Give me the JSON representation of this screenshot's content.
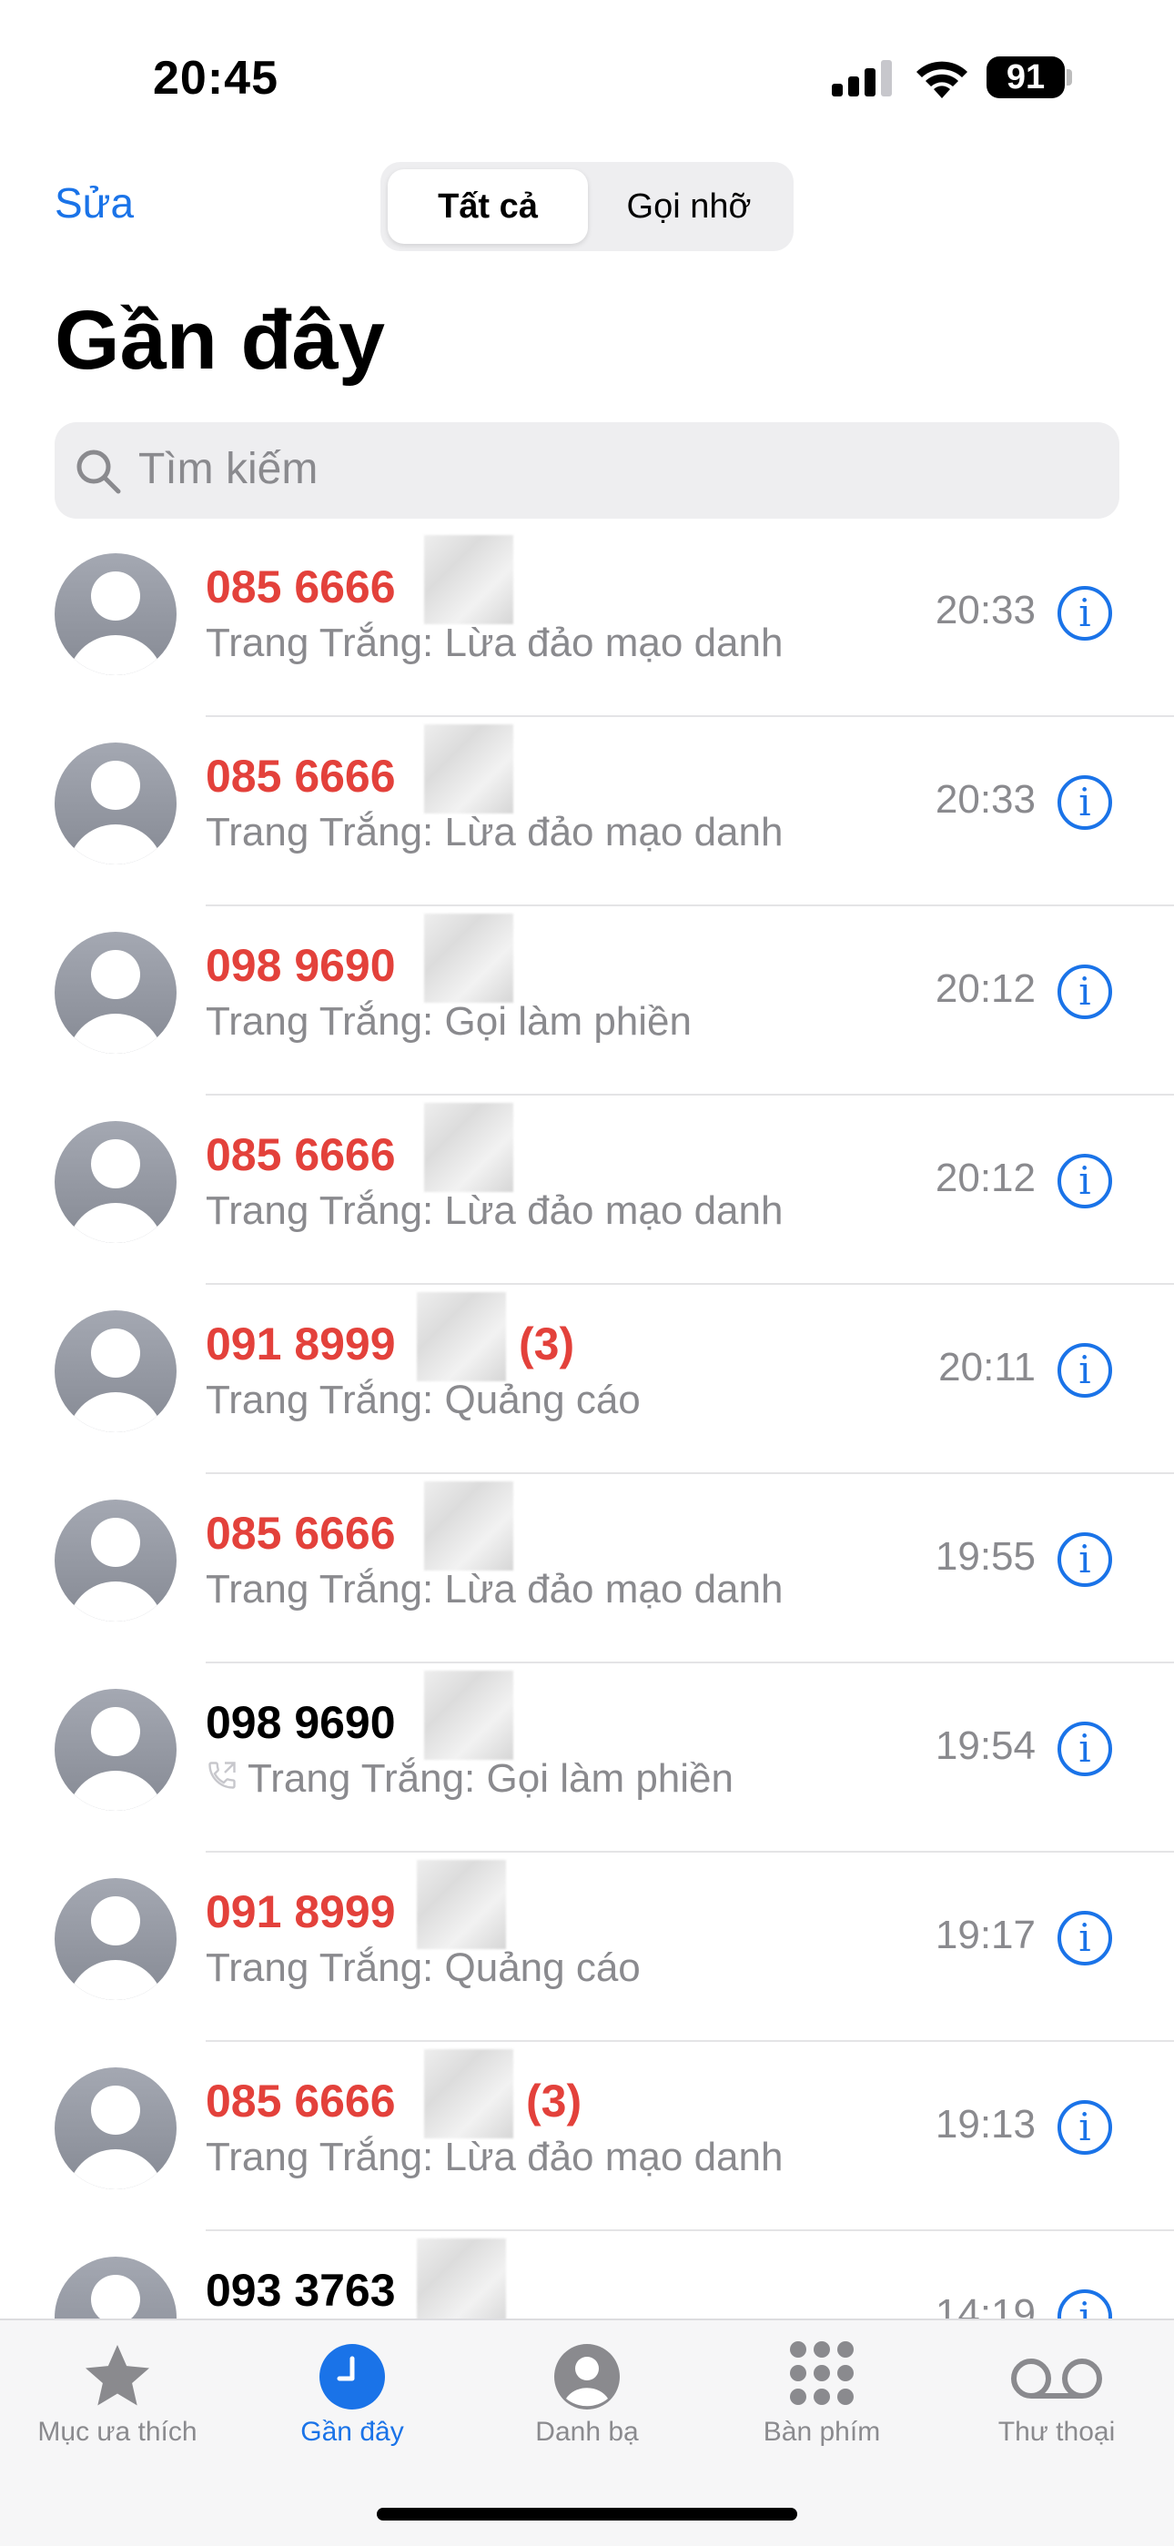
{
  "status": {
    "time": "20:45",
    "battery": "91"
  },
  "nav": {
    "edit": "Sửa",
    "seg_all": "Tất cả",
    "seg_missed": "Gọi nhỡ",
    "title": "Gần đây"
  },
  "search": {
    "placeholder": "Tìm kiếm"
  },
  "calls": [
    {
      "number": "085 6666",
      "count": "",
      "label": "Trang Trắng: Lừa đảo mạo danh",
      "time": "20:33",
      "missed": true,
      "outgoing": false
    },
    {
      "number": "085 6666",
      "count": "",
      "label": "Trang Trắng: Lừa đảo mạo danh",
      "time": "20:33",
      "missed": true,
      "outgoing": false
    },
    {
      "number": "098 9690",
      "count": "",
      "label": "Trang Trắng: Gọi làm phiền",
      "time": "20:12",
      "missed": true,
      "outgoing": false
    },
    {
      "number": "085 6666",
      "count": "",
      "label": "Trang Trắng: Lừa đảo mạo danh",
      "time": "20:12",
      "missed": true,
      "outgoing": false
    },
    {
      "number": "091 8999",
      "count": "(3)",
      "label": "Trang Trắng: Quảng cáo",
      "time": "20:11",
      "missed": true,
      "outgoing": false
    },
    {
      "number": "085 6666",
      "count": "",
      "label": "Trang Trắng: Lừa đảo mạo danh",
      "time": "19:55",
      "missed": true,
      "outgoing": false
    },
    {
      "number": "098 9690",
      "count": "",
      "label": "Trang Trắng: Gọi làm phiền",
      "time": "19:54",
      "missed": false,
      "outgoing": true
    },
    {
      "number": "091 8999",
      "count": "",
      "label": "Trang Trắng: Quảng cáo",
      "time": "19:17",
      "missed": true,
      "outgoing": false
    },
    {
      "number": "085 6666",
      "count": "(3)",
      "label": "Trang Trắng: Lừa đảo mạo danh",
      "time": "19:13",
      "missed": true,
      "outgoing": false
    },
    {
      "number": "093 3763",
      "count": "",
      "label": "",
      "time": "14:19",
      "missed": false,
      "outgoing": false
    }
  ],
  "tabs": [
    {
      "label": "Mục ưa thích",
      "icon": "star-icon",
      "active": false
    },
    {
      "label": "Gần đây",
      "icon": "clock-icon",
      "active": true
    },
    {
      "label": "Danh bạ",
      "icon": "contact-icon",
      "active": false
    },
    {
      "label": "Bàn phím",
      "icon": "keypad-icon",
      "active": false
    },
    {
      "label": "Thư thoại",
      "icon": "voicemail-icon",
      "active": false
    }
  ],
  "colors": {
    "accent": "#1a73e8",
    "missed": "#e3413b",
    "secondary": "#8a8a8e"
  }
}
